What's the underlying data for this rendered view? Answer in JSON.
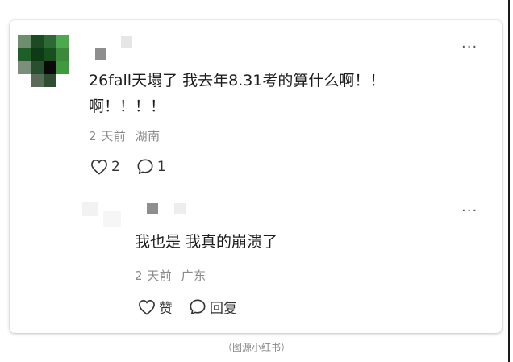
{
  "comment": {
    "text": "26fall天塌了 我去年8.31考的算什么啊！！\n啊！！！！",
    "time": "2 天前",
    "location": "湖南",
    "like_count": "2",
    "reply_count": "1",
    "more_icon": "more-dots-icon"
  },
  "reply": {
    "text": "我也是 我真的崩溃了",
    "time": "2 天前",
    "location": "广东",
    "like_label": "赞",
    "reply_label": "回复",
    "more_icon": "more-dots-icon"
  },
  "more_glyph": "···",
  "caption": "（图源小红书）",
  "colors": {
    "avatar_green": "#2e7d32",
    "meta_gray": "#8a8a8a",
    "text": "#1d1d1d"
  }
}
